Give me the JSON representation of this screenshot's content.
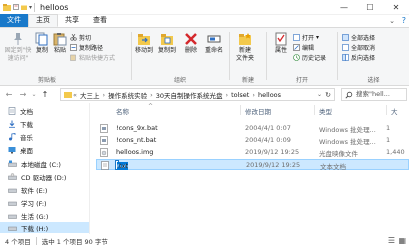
{
  "titlebar": {
    "title": "helloos"
  },
  "tabs": [
    {
      "label": "文件"
    },
    {
      "label": "主页"
    },
    {
      "label": "共享"
    },
    {
      "label": "查看"
    }
  ],
  "ribbon": {
    "clipboard": {
      "pin_label_1": "固定到\"快",
      "pin_label_2": "速访问\"",
      "copy": "复制",
      "paste": "粘贴",
      "cut": "剪切",
      "copy_path": "复制路径",
      "paste_shortcut": "粘贴快捷方式",
      "group": "剪贴板"
    },
    "organize": {
      "move_to": "移动到",
      "copy_to": "复制到",
      "delete": "删除",
      "rename": "重命名",
      "group": "组织"
    },
    "new": {
      "new_folder_1": "新建",
      "new_folder_2": "文件夹",
      "group": "新建"
    },
    "open": {
      "properties": "属性",
      "open": "打开",
      "edit": "编辑",
      "history": "历史记录",
      "group": "打开"
    },
    "select": {
      "select_all": "全部选择",
      "select_none": "全部取消",
      "invert": "反向选择",
      "group": "选择"
    }
  },
  "address": {
    "crumbs": [
      "大三上",
      "操作系统实验",
      "30天自制操作系统光盘",
      "tolset",
      "helloos"
    ],
    "search_placeholder": "搜索\"hell..."
  },
  "nav": {
    "items": [
      {
        "label": "文档",
        "icon": "document-icon"
      },
      {
        "label": "下载",
        "icon": "download-icon"
      },
      {
        "label": "音乐",
        "icon": "music-icon"
      },
      {
        "label": "桌面",
        "icon": "desktop-icon"
      },
      {
        "label": "本地磁盘 (C:)",
        "icon": "drive-icon"
      },
      {
        "label": "CD 驱动器 (D:)",
        "icon": "cd-drive-icon"
      },
      {
        "label": "软件 (E:)",
        "icon": "drive-icon"
      },
      {
        "label": "学习 (F:)",
        "icon": "drive-icon"
      },
      {
        "label": "生活 (G:)",
        "icon": "drive-icon"
      },
      {
        "label": "下载 (H:)",
        "icon": "drive-icon"
      }
    ]
  },
  "content": {
    "columns": {
      "name": "名称",
      "date": "修改日期",
      "type": "类型",
      "size": "大"
    },
    "files": [
      {
        "name": "!cons_9x.bat",
        "date": "2004/4/1 0:07",
        "type": "Windows 批处理...",
        "size": "1"
      },
      {
        "name": "!cons_nt.bat",
        "date": "2004/4/1 0:09",
        "type": "Windows 批处理...",
        "size": "1"
      },
      {
        "name": "helloos.img",
        "date": "2019/9/12 19:25",
        "type": "光盘映像文件",
        "size": "1,440"
      },
      {
        "name": "run.txt",
        "date": "2019/9/12 19:25",
        "type": "文本文档",
        "size": ""
      }
    ],
    "rename_selected": "run",
    "rename_rest": ".txt"
  },
  "status": {
    "count": "4 个项目",
    "selected": "选中 1 个项目  90 字节"
  }
}
